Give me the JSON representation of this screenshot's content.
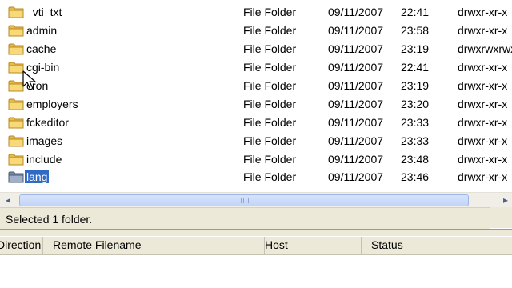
{
  "files": [
    {
      "name": "_vti_txt",
      "type": "File Folder",
      "date": "09/11/2007",
      "time": "22:41",
      "perms": "drwxr-xr-x"
    },
    {
      "name": "admin",
      "type": "File Folder",
      "date": "09/11/2007",
      "time": "23:58",
      "perms": "drwxr-xr-x"
    },
    {
      "name": "cache",
      "type": "File Folder",
      "date": "09/11/2007",
      "time": "23:19",
      "perms": "drwxrwxrwx"
    },
    {
      "name": "cgi-bin",
      "type": "File Folder",
      "date": "09/11/2007",
      "time": "22:41",
      "perms": "drwxr-xr-x"
    },
    {
      "name": "cron",
      "type": "File Folder",
      "date": "09/11/2007",
      "time": "23:19",
      "perms": "drwxr-xr-x"
    },
    {
      "name": "employers",
      "type": "File Folder",
      "date": "09/11/2007",
      "time": "23:20",
      "perms": "drwxr-xr-x"
    },
    {
      "name": "fckeditor",
      "type": "File Folder",
      "date": "09/11/2007",
      "time": "23:33",
      "perms": "drwxr-xr-x"
    },
    {
      "name": "images",
      "type": "File Folder",
      "date": "09/11/2007",
      "time": "23:33",
      "perms": "drwxr-xr-x"
    },
    {
      "name": "include",
      "type": "File Folder",
      "date": "09/11/2007",
      "time": "23:48",
      "perms": "drwxr-xr-x"
    },
    {
      "name": "lang",
      "type": "File Folder",
      "date": "09/11/2007",
      "time": "23:46",
      "perms": "drwxr-xr-x"
    }
  ],
  "selected_index": 9,
  "status": {
    "text": "Selected 1 folder."
  },
  "queue": {
    "columns": [
      "Direction",
      "Remote Filename",
      "Host",
      "Status"
    ]
  },
  "colors": {
    "selection": "#316ac5",
    "folder": "#f2c95a"
  },
  "icons": {
    "folder": "folder-icon",
    "cursor": "mouse-pointer-icon"
  }
}
